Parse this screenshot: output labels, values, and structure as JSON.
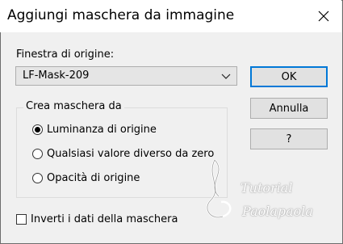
{
  "dialog": {
    "title": "Aggiungi maschera da immagine",
    "close_icon": "close-icon"
  },
  "source": {
    "label": "Finestra di origine:",
    "selected": "LF-Mask-209"
  },
  "buttons": {
    "ok": "OK",
    "cancel": "Annulla",
    "help": "?"
  },
  "mask_group": {
    "title": "Crea maschera da",
    "options": [
      {
        "label": "Luminanza di origine",
        "selected": true
      },
      {
        "label": "Qualsiasi valore diverso da zero",
        "selected": false
      },
      {
        "label": "Opacità di origine",
        "selected": false
      }
    ]
  },
  "invert": {
    "label": "Inverti i dati della maschera",
    "checked": false
  },
  "watermark": {
    "line1": "Tutorial",
    "line2": "Paolapaola"
  },
  "colors": {
    "accent": "#0078d7",
    "background": "#f0f0f0",
    "titlebar": "#ffffff"
  }
}
